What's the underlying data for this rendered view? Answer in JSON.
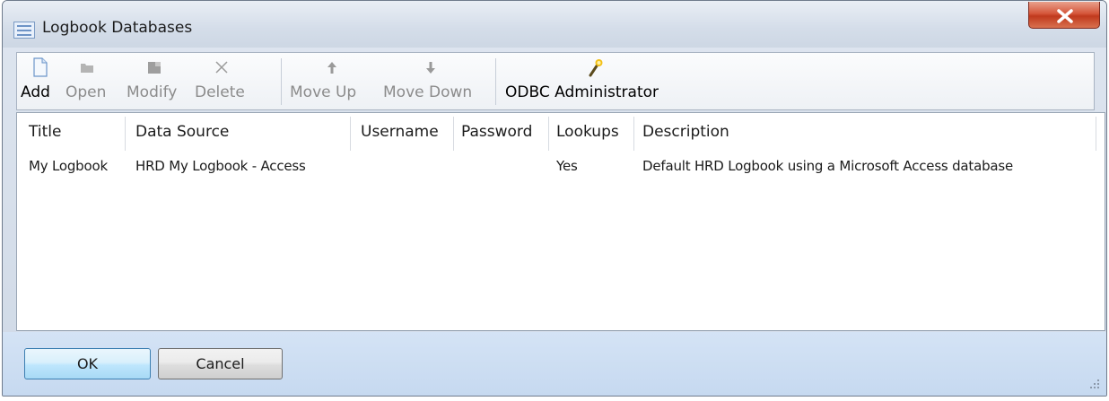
{
  "window": {
    "title": "Logbook Databases"
  },
  "toolbar": {
    "add": "Add",
    "open": "Open",
    "modify": "Modify",
    "delete": "Delete",
    "move_up": "Move Up",
    "move_down": "Move Down",
    "odbc": "ODBC Administrator"
  },
  "table": {
    "columns": [
      "Title",
      "Data Source",
      "Username",
      "Password",
      "Lookups",
      "Description"
    ],
    "rows": [
      [
        "My Logbook",
        "HRD My Logbook - Access",
        "",
        "",
        "Yes",
        "Default HRD Logbook using a Microsoft Access database"
      ]
    ]
  },
  "footer": {
    "ok": "OK",
    "cancel": "Cancel"
  },
  "colors": {
    "close_button": "#c7442a",
    "footer_bg": "#c6d9f0",
    "default_button_border": "#3c7fb1"
  }
}
